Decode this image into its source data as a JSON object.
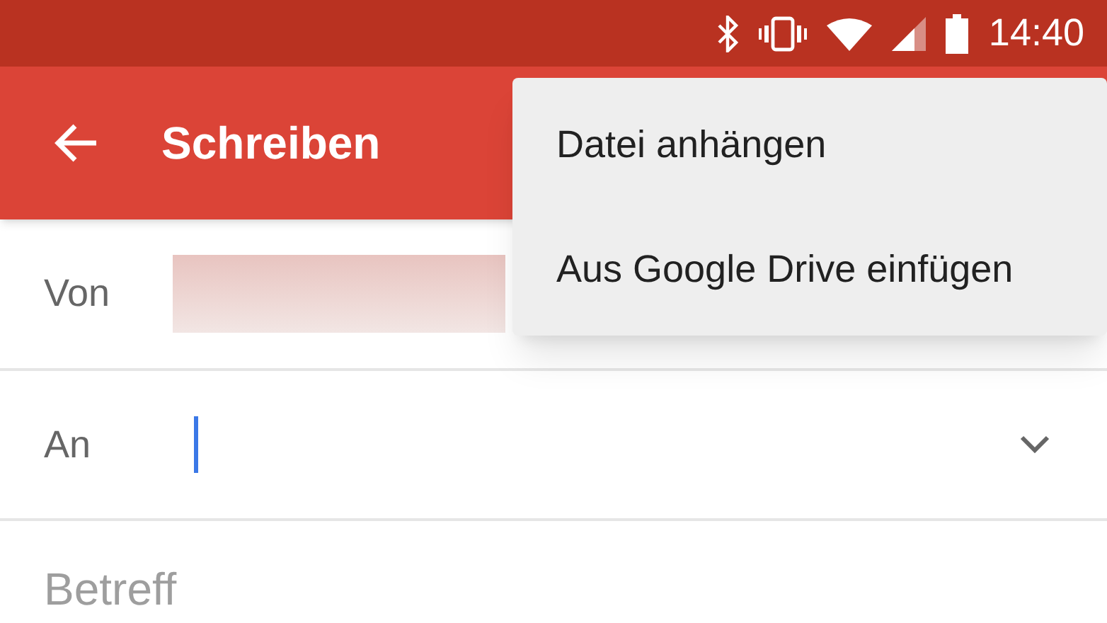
{
  "status_bar": {
    "time": "14:40"
  },
  "app_bar": {
    "title": "Schreiben"
  },
  "menu": {
    "items": [
      {
        "label": "Datei anhängen"
      },
      {
        "label": "Aus Google Drive einfügen"
      }
    ]
  },
  "form": {
    "from": {
      "label": "Von",
      "redacted": true
    },
    "to": {
      "label": "An",
      "focused": true
    },
    "subject": {
      "placeholder": "Betreff"
    }
  }
}
